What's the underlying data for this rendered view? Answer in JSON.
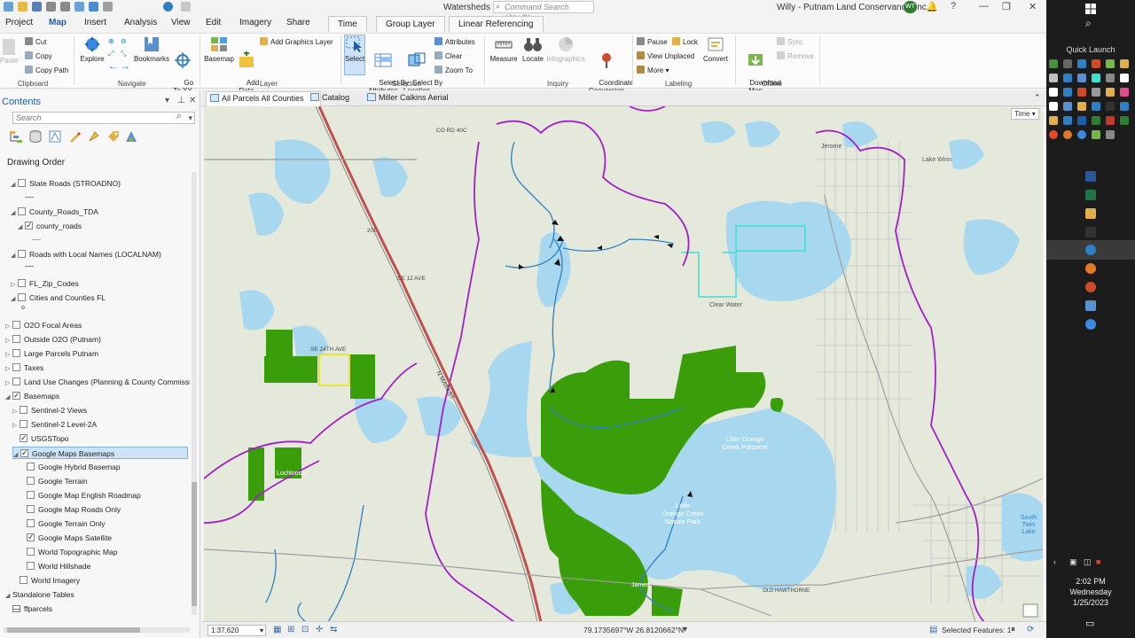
{
  "window": {
    "title": "Watersheds",
    "command_search_placeholder": "Command Search (Alt+Q)",
    "user": "Willy - Putnam Land Conservancy, Inc.",
    "user_initials": "WT"
  },
  "ribbon_tabs": [
    "Project",
    "Map",
    "Insert",
    "Analysis",
    "View",
    "Edit",
    "Imagery",
    "Share"
  ],
  "ribbon_context_tabs": [
    "Time",
    "Group Layer",
    "Linear Referencing"
  ],
  "active_tab": "Map",
  "ribbon": {
    "clipboard": {
      "label": "Clipboard",
      "paste": "Paste",
      "cut": "Cut",
      "copy": "Copy",
      "copy_path": "Copy Path"
    },
    "navigate": {
      "label": "Navigate",
      "explore": "Explore",
      "bookmarks": "Bookmarks",
      "goto": "Go\nTo XY"
    },
    "layer": {
      "label": "Layer",
      "basemap": "Basemap",
      "add_data": "Add\nData",
      "add_graphics": "Add Graphics Layer"
    },
    "selection": {
      "label": "Selection",
      "select": "Select",
      "select_by_attr": "Select By\nAttributes",
      "select_by_loc": "Select By\nLocation",
      "attributes": "Attributes",
      "clear": "Clear",
      "zoom_to": "Zoom To"
    },
    "inquiry": {
      "label": "Inquiry",
      "measure": "Measure",
      "locate": "Locate",
      "infographics": "Infographics",
      "coord_conv": "Coordinate\nConversion"
    },
    "labeling": {
      "label": "Labeling",
      "pause": "Pause",
      "lock": "Lock",
      "view_unplaced": "View Unplaced",
      "more": "More",
      "convert": "Convert"
    },
    "offline": {
      "label": "Offline",
      "download_map": "Download\nMap",
      "sync": "Sync",
      "remove": "Remove"
    }
  },
  "contents": {
    "title": "Contents",
    "search_placeholder": "Search",
    "drawing_order": "Drawing Order",
    "layers": [
      {
        "label": "State Roads (STROADNO)",
        "checked": false,
        "indent": 1,
        "expanded": true
      },
      {
        "label": "County_Roads_TDA",
        "checked": false,
        "indent": 1,
        "expanded": true
      },
      {
        "label": "county_roads",
        "checked": true,
        "indent": 2,
        "expanded": true
      },
      {
        "label": "Roads with Local Names (LOCALNAM)",
        "checked": false,
        "indent": 1,
        "expanded": true
      },
      {
        "label": "FL_Zip_Codes",
        "checked": false,
        "indent": 1,
        "expanded": false
      },
      {
        "label": "Cities and Counties FL",
        "checked": false,
        "indent": 1,
        "expanded": true
      },
      {
        "label": "O2O Focal Areas",
        "checked": false,
        "indent": 0,
        "expanded": false
      },
      {
        "label": "Outside O2O (Putnam)",
        "checked": false,
        "indent": 0,
        "expanded": false
      },
      {
        "label": "Large Parcels Putnam",
        "checked": false,
        "indent": 0,
        "expanded": false
      },
      {
        "label": "Taxes",
        "checked": false,
        "indent": 0,
        "expanded": false
      },
      {
        "label": "Land Use Changes (Planning & County Commission",
        "checked": false,
        "indent": 0,
        "expanded": false
      },
      {
        "label": "Basemaps",
        "checked": true,
        "indent": 0,
        "expanded": true
      },
      {
        "label": "Sentinel-2 Views",
        "checked": false,
        "indent": 1,
        "expanded": false
      },
      {
        "label": "Sentinel-2 Level-2A",
        "checked": false,
        "indent": 1,
        "expanded": false
      },
      {
        "label": "USGSTopo",
        "checked": true,
        "indent": 1,
        "expanded": false
      },
      {
        "label": "Google Maps Basemaps",
        "checked": true,
        "indent": 1,
        "expanded": true,
        "selected": true
      },
      {
        "label": "Google Hybrid Basemap",
        "checked": false,
        "indent": 2
      },
      {
        "label": "Google Terrain",
        "checked": false,
        "indent": 2
      },
      {
        "label": "Google Map English Roadmap",
        "checked": false,
        "indent": 2
      },
      {
        "label": "Google Map Roads Only",
        "checked": false,
        "indent": 2
      },
      {
        "label": "Google Terrain Only",
        "checked": false,
        "indent": 2
      },
      {
        "label": "Google Maps Satellite",
        "checked": true,
        "indent": 2
      },
      {
        "label": "World Topographic Map",
        "checked": false,
        "indent": 2
      },
      {
        "label": "World Hillshade",
        "checked": false,
        "indent": 2
      },
      {
        "label": "World Imagery",
        "checked": false,
        "indent": 1
      },
      {
        "label": "Standalone Tables",
        "checked": null,
        "indent": 0,
        "expanded": true
      },
      {
        "label": "ffparcels",
        "checked": null,
        "indent": 1,
        "table": true
      }
    ]
  },
  "map_tabs": [
    "All Parcels All Counties",
    "Catalog",
    "Miller Calkins Aerial"
  ],
  "map": {
    "time_button": "Time",
    "labels": {
      "little_orange": "Little Orange\nCreek Preserve",
      "little_orange_park": "Little\nOrange Creek\nNature Park",
      "clear_water": "Clear Water",
      "se24th": "SE 24TH AVE",
      "se12": "SE 12 AVE",
      "north_main": "N MAIN ST",
      "co_rd": "CO RD 40C",
      "jerome": "Jerome",
      "lake_winn": "Lake Winn",
      "south_twin": "South\nTwin\nLake",
      "james": "James",
      "old_hawthorne": "OLD HAWTHORNE",
      "lochloosa": "Lochloosa",
      "hwy": "201"
    }
  },
  "status": {
    "scale": "1:37,620",
    "coords": "79.1735697°W 26.8120662°N",
    "selected_features": "Selected Features: 1"
  },
  "taskbar": {
    "quick_launch": "Quick Launch",
    "time": "2:02 PM",
    "day": "Wednesday",
    "date": "1/25/2023"
  },
  "colors": {
    "accent": "#1a5fa8",
    "water": "#a8d8f0",
    "parcel_green": "#3a9e0a",
    "boundary_purple": "#a020c8",
    "stream_blue": "#2f7fc4",
    "highway_red": "#c0504d"
  }
}
